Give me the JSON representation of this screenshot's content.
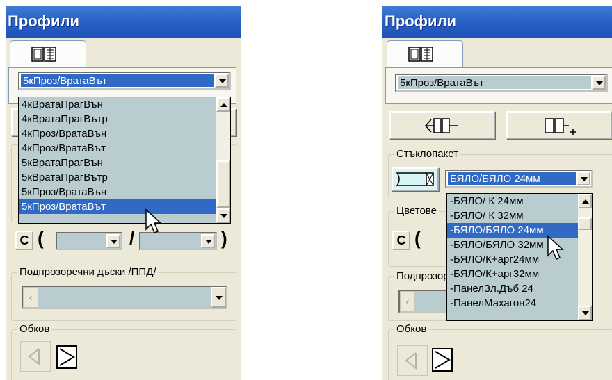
{
  "left_panel": {
    "title": "Профили",
    "profile_combo": {
      "value": "5кПроз/ВратаВът"
    },
    "dropdown_list": [
      {
        "label": "4кВратаПрагВън",
        "selected": false
      },
      {
        "label": "4кВратаПрагВътр",
        "selected": false
      },
      {
        "label": "4кПроз/ВратаВън",
        "selected": false
      },
      {
        "label": "4кПроз/ВратаВът",
        "selected": false
      },
      {
        "label": "5кВратаПрагВън",
        "selected": false
      },
      {
        "label": "5кВратаПрагВътр",
        "selected": false
      },
      {
        "label": "5кПроз/ВратаВън",
        "selected": false
      },
      {
        "label": "5кПроз/ВратаВът",
        "selected": true
      }
    ],
    "c_button": "C",
    "paren_open": "(",
    "slash": "/",
    "paren_close": ")",
    "sills_group": "Подпрозоречни дъски /ППД/",
    "hardware_group": "Обков"
  },
  "right_panel": {
    "title": "Профили",
    "profile_combo": {
      "value": "5кПроз/ВратаВът"
    },
    "glass_group": "Стъклопакет",
    "glass_combo": {
      "value": "БЯЛО/БЯЛО 24мм"
    },
    "glass_list": [
      {
        "label": "-БЯЛО/ К 24мм",
        "selected": false
      },
      {
        "label": "-БЯЛО/ К 32мм",
        "selected": false
      },
      {
        "label": "-БЯЛО/БЯЛО 24мм",
        "selected": true
      },
      {
        "label": "-БЯЛО/БЯЛО 32мм",
        "selected": false
      },
      {
        "label": "-БЯЛО/К+арг24мм",
        "selected": false
      },
      {
        "label": "-БЯЛО/К+арг32мм",
        "selected": false
      },
      {
        "label": "-ПанелЗл.Дъб 24",
        "selected": false
      },
      {
        "label": "-ПанелМахагон24",
        "selected": false
      }
    ],
    "colors_group": "Цветове",
    "c_button": "C",
    "paren_open": "(",
    "sills_group": "Подпрозоречни дъски /ППД/",
    "hardware_group": "Обков"
  },
  "colors": {
    "title_bar": "#2a62c6",
    "panel_bg": "#ece9d8",
    "list_bg": "#b9ccd0",
    "selection": "#316ac5"
  },
  "icons": [
    "profile-tab-icon",
    "swap-profile-icon",
    "add-profile-icon",
    "glass-unit-icon",
    "hardware-arrow-icon",
    "sash-triangle-icon",
    "mouse-cursor-icon"
  ]
}
